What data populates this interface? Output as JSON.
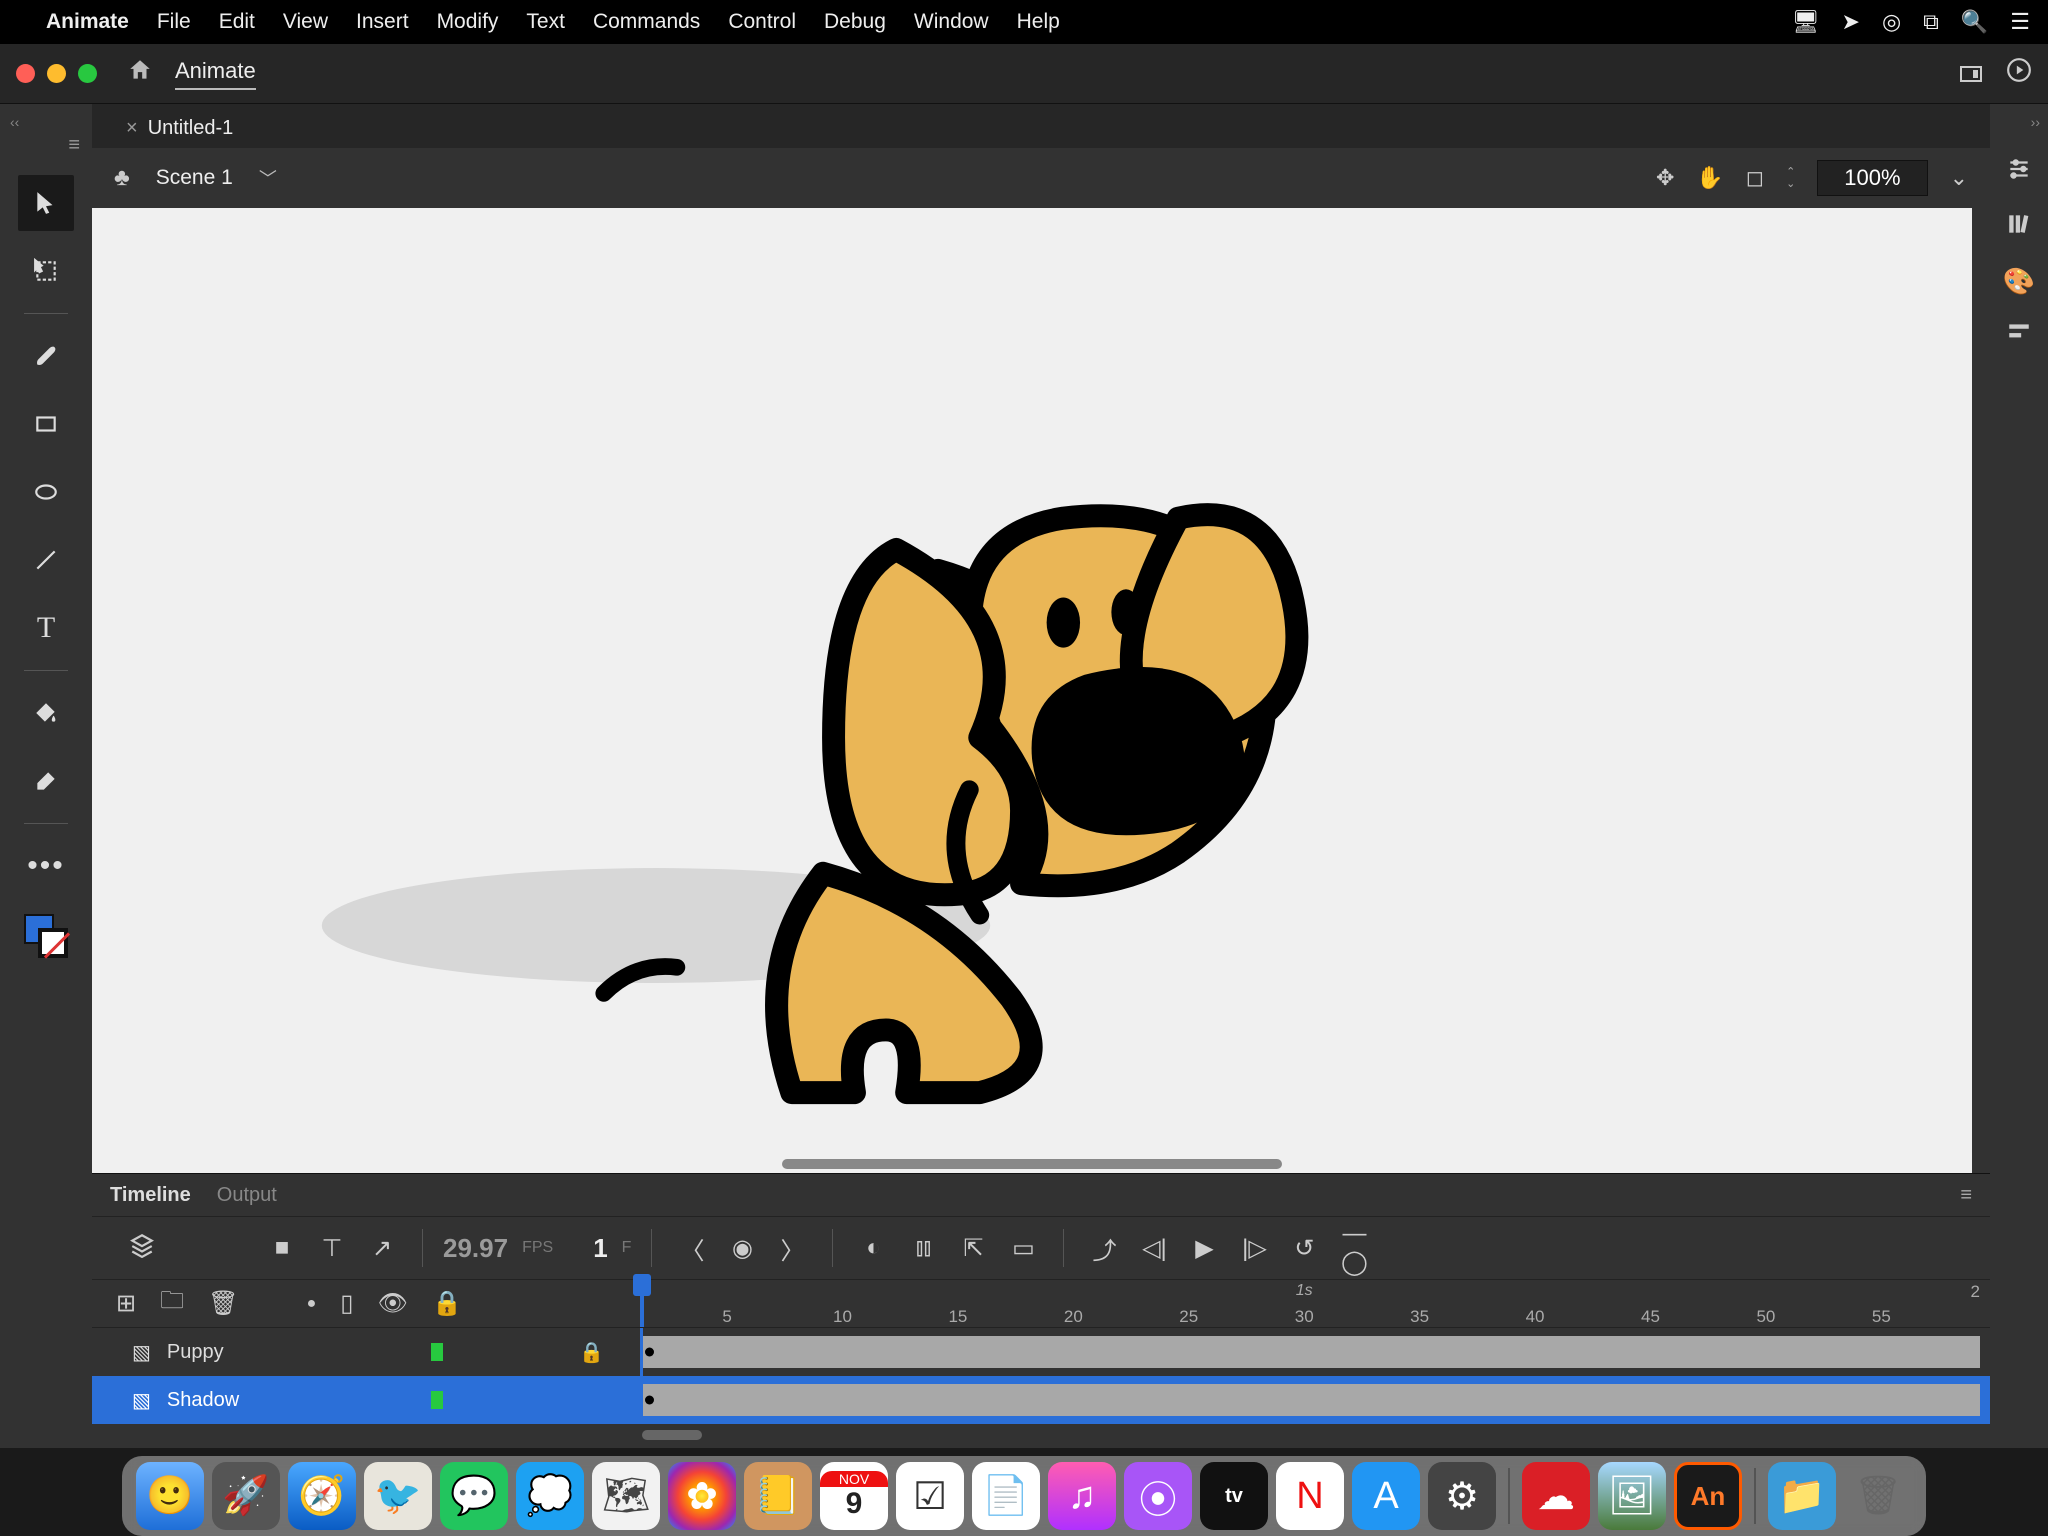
{
  "menubar": {
    "app": "Animate",
    "items": [
      "File",
      "Edit",
      "View",
      "Insert",
      "Modify",
      "Text",
      "Commands",
      "Control",
      "Debug",
      "Window",
      "Help"
    ]
  },
  "window": {
    "workspace": "Animate"
  },
  "document": {
    "tab": "Untitled-1"
  },
  "scene": {
    "name": "Scene 1",
    "zoom": "100%"
  },
  "timeline": {
    "tabs": {
      "timeline": "Timeline",
      "output": "Output"
    },
    "fps": "29.97",
    "fps_label": "FPS",
    "frame": "1",
    "frame_label": "F",
    "time_marker": "1s",
    "end_marker": "2",
    "ticks": [
      "5",
      "10",
      "15",
      "20",
      "25",
      "30",
      "35",
      "40",
      "45",
      "50",
      "55"
    ],
    "layers": [
      {
        "name": "Puppy",
        "locked": true,
        "selected": false
      },
      {
        "name": "Shadow",
        "locked": false,
        "selected": true
      }
    ]
  },
  "dock": {
    "calendar_month": "NOV",
    "calendar_day": "9",
    "an_label": "An",
    "tv_label": "tv"
  }
}
